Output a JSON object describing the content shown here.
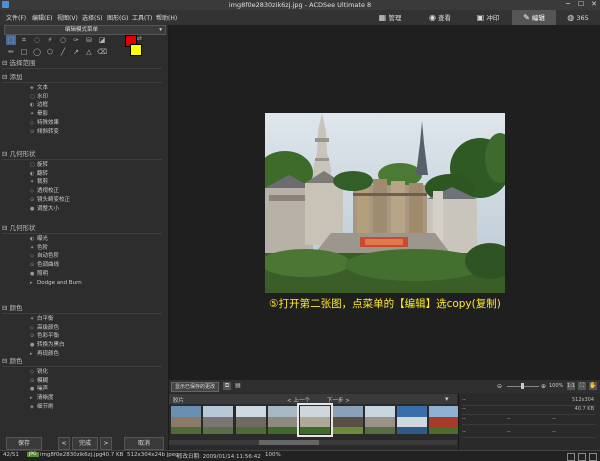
{
  "window": {
    "title": "img8f0e2830zik6zj.jpg - ACDSee Ultimate 8",
    "min": "─",
    "max": "☐",
    "close": "✕"
  },
  "menu": [
    "文件(F)",
    "编辑(E)",
    "视图(V)",
    "选择(S)",
    "图形(G)",
    "工具(T)",
    "帮助(H)"
  ],
  "modes": [
    "管理",
    "查看",
    "冲印",
    "编辑",
    "365"
  ],
  "active_mode": "编辑",
  "left": {
    "dropdown": "编辑模式菜单",
    "colors": {
      "foreground": "#e00000",
      "background": "#ffff00"
    },
    "sections": [
      {
        "title": "选择范围",
        "items": []
      },
      {
        "title": "添加",
        "items": [
          "文本",
          "水印",
          "边框",
          "晕影",
          "特殊效果",
          "倾斜转变"
        ]
      },
      {
        "title": "几何形状",
        "items": [
          "旋转",
          "翻转",
          "裁剪",
          "透视校正",
          "镜头畸变校正",
          "调整大小"
        ]
      },
      {
        "title": "几何形状",
        "items": [
          "曝光",
          "色阶",
          "自动色阶",
          "色调曲线",
          "照明",
          "Dodge and Burn"
        ]
      },
      {
        "title": "颜色",
        "items": [
          "白平衡",
          "高级颜色",
          "色彩平衡",
          "转换为黑白",
          "再现颜色"
        ]
      },
      {
        "title": "颜色",
        "items": [
          "锐化",
          "模糊",
          "噪声",
          "清晰度",
          "细节刷"
        ]
      }
    ],
    "buttons": [
      "保存",
      "完成",
      "取消"
    ],
    "nav_prev": "<",
    "nav_next": ">"
  },
  "caption": "⑤打开第二张图，点菜单的【编辑】选copy(复制)",
  "zoom": {
    "label": "显示已保存的更改",
    "value": "100%"
  },
  "filmstrip": {
    "title": "胶片",
    "prev": "< 上一个",
    "next": "下一步 >",
    "count": 9
  },
  "info": {
    "dims": "512x304",
    "size": "40.7 KB",
    "placeholder": "--"
  },
  "status": {
    "index": "42/51",
    "type": "JPG",
    "file": "img8f0e2830zik6zj.jpg",
    "size": "40.7 KB",
    "dims": "512x304x24b jpeg",
    "date": "修改日期: 2009/01/14 11:56:42",
    "zoom": "100%"
  }
}
